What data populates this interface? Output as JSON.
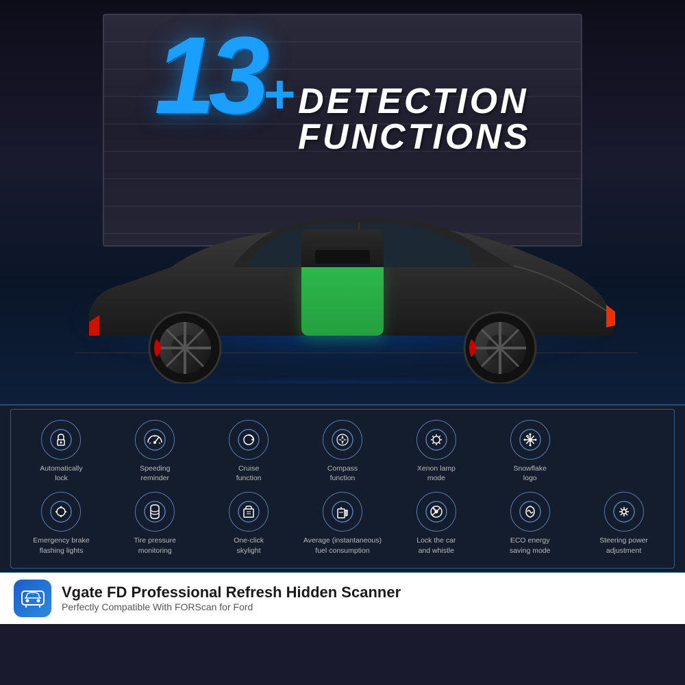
{
  "hero": {
    "number": "13",
    "plus": "+",
    "line1": "DETECTION",
    "line2": "FUNCTIONS"
  },
  "functions_row1": [
    {
      "id": "auto-lock",
      "icon": "🔒",
      "label": "Automatically\nlock"
    },
    {
      "id": "speed-reminder",
      "icon": "🏎",
      "label": "Speeding\nreminder"
    },
    {
      "id": "cruise",
      "icon": "🔄",
      "label": "Cruise\nfunction"
    },
    {
      "id": "compass",
      "icon": "🧭",
      "label": "Compass\nfunction"
    },
    {
      "id": "xenon",
      "icon": "💡",
      "label": "Xenon lamp\nmode"
    },
    {
      "id": "snowflake",
      "icon": "❄",
      "label": "Snowflake\nlogo"
    }
  ],
  "functions_row2": [
    {
      "id": "emergency-brake",
      "icon": "💥",
      "label": "Emergency brake\nflashing lights"
    },
    {
      "id": "tire-pressure",
      "icon": "🌀",
      "label": "Tire pressure\nmonitoring"
    },
    {
      "id": "skylight",
      "icon": "🚗",
      "label": "One-click\nskylight"
    },
    {
      "id": "fuel",
      "icon": "⛽",
      "label": "Average (instantaneous)\nfuel consumption"
    },
    {
      "id": "lock-whistle",
      "icon": "🎵",
      "label": "Lock the car\nand whistle"
    },
    {
      "id": "eco",
      "icon": "🌿",
      "label": "ECO energy\nsaving mode"
    },
    {
      "id": "steering",
      "icon": "⚙",
      "label": "Steering power\nadjustment"
    }
  ],
  "brand": {
    "title": "Vgate FD Professional Refresh Hidden Scanner",
    "subtitle": "Perfectly Compatible With FORScan for Ford",
    "app_icon": "🚗"
  }
}
